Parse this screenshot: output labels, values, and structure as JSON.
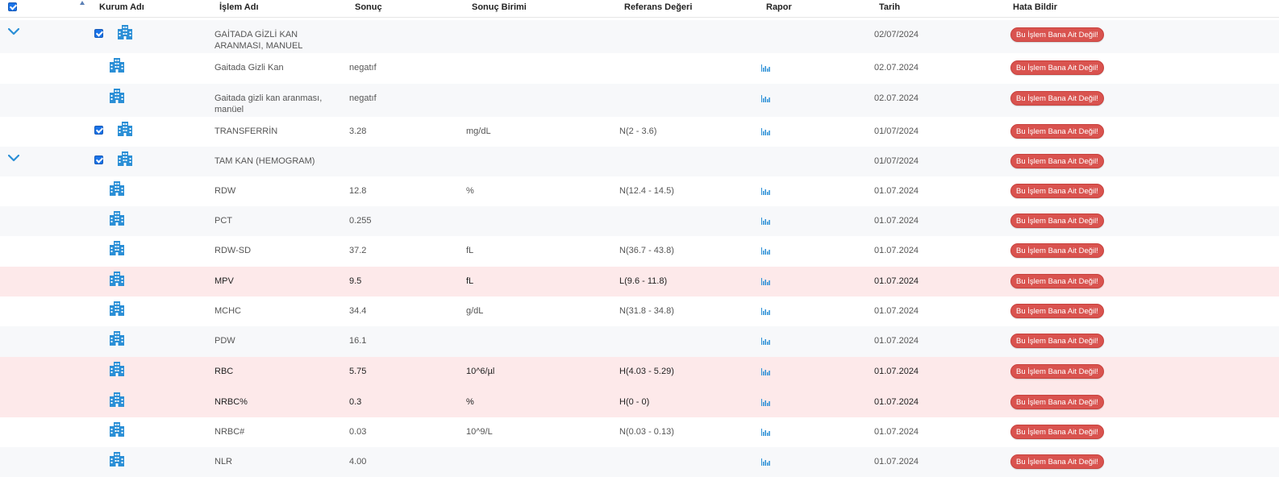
{
  "header": {
    "kurum": "Kurum Adı",
    "islem": "İşlem Adı",
    "sonuc": "Sonuç",
    "birim": "Sonuç Birimi",
    "referans": "Referans Değeri",
    "rapor": "Rapor",
    "tarih": "Tarih",
    "hata": "Hata Bildir"
  },
  "button_label": "Bu İşlem Bana Ait Değil!",
  "colors": {
    "accent": "#1a73e8",
    "error_button": "#d9534f",
    "abnormal_row": "#fde9ea",
    "icon_blue": "#2b8fd6"
  },
  "rows": [
    {
      "type": "group",
      "expand": true,
      "checkbox": true,
      "name": "GAİTADA GİZLİ KAN ARANMASI, MANUEL",
      "name_lines": [
        "GAİTADA GİZLİ KAN",
        "ARANMASI, MANUEL"
      ],
      "value": "",
      "unit": "",
      "ref": "",
      "rapor": false,
      "date": "02/07/2024"
    },
    {
      "type": "child",
      "name": "Gaitada Gizli Kan",
      "name_lines": [
        "Gaitada Gizli Kan"
      ],
      "value": "negatıf",
      "unit": "",
      "ref": "",
      "rapor": true,
      "date": "02.07.2024"
    },
    {
      "type": "child",
      "name": "Gaitada gizli kan aranması, manüel",
      "name_lines": [
        "Gaitada gizli kan aranması,",
        "manüel"
      ],
      "value": "negatıf",
      "unit": "",
      "ref": "",
      "rapor": true,
      "date": "02.07.2024"
    },
    {
      "type": "single",
      "checkbox": true,
      "name": "TRANSFERRİN",
      "name_lines": [
        "TRANSFERRİN"
      ],
      "value": "3.28",
      "unit": "mg/dL",
      "ref": "N(2 - 3.6)",
      "rapor": true,
      "date": "01/07/2024"
    },
    {
      "type": "group",
      "expand": true,
      "checkbox": true,
      "name": "TAM KAN (HEMOGRAM)",
      "name_lines": [
        "TAM KAN (HEMOGRAM)"
      ],
      "value": "",
      "unit": "",
      "ref": "",
      "rapor": false,
      "date": "01/07/2024"
    },
    {
      "type": "child",
      "name": "RDW",
      "name_lines": [
        "RDW"
      ],
      "value": "12.8",
      "unit": "%",
      "ref": "N(12.4 - 14.5)",
      "rapor": true,
      "date": "01.07.2024"
    },
    {
      "type": "child",
      "name": "PCT",
      "name_lines": [
        "PCT"
      ],
      "value": "0.255",
      "unit": "",
      "ref": "",
      "rapor": true,
      "date": "01.07.2024"
    },
    {
      "type": "child",
      "name": "RDW-SD",
      "name_lines": [
        "RDW-SD"
      ],
      "value": "37.2",
      "unit": "fL",
      "ref": "N(36.7 - 43.8)",
      "rapor": true,
      "date": "01.07.2024"
    },
    {
      "type": "child",
      "abnormal": true,
      "name": "MPV",
      "name_lines": [
        "MPV"
      ],
      "value": "9.5",
      "unit": "fL",
      "ref": "L(9.6 - 11.8)",
      "rapor": true,
      "date": "01.07.2024"
    },
    {
      "type": "child",
      "name": "MCHC",
      "name_lines": [
        "MCHC"
      ],
      "value": "34.4",
      "unit": "g/dL",
      "ref": "N(31.8 - 34.8)",
      "rapor": true,
      "date": "01.07.2024"
    },
    {
      "type": "child",
      "name": "PDW",
      "name_lines": [
        "PDW"
      ],
      "value": "16.1",
      "unit": "",
      "ref": "",
      "rapor": true,
      "date": "01.07.2024"
    },
    {
      "type": "child",
      "abnormal": true,
      "name": "RBC",
      "name_lines": [
        "RBC"
      ],
      "value": "5.75",
      "unit": "10^6/µl",
      "ref": "H(4.03 - 5.29)",
      "rapor": true,
      "date": "01.07.2024"
    },
    {
      "type": "child",
      "abnormal": true,
      "name": "NRBC%",
      "name_lines": [
        "NRBC%"
      ],
      "value": "0.3",
      "unit": "%",
      "ref": "H(0 - 0)",
      "rapor": true,
      "date": "01.07.2024"
    },
    {
      "type": "child",
      "name": "NRBC#",
      "name_lines": [
        "NRBC#"
      ],
      "value": "0.03",
      "unit": "10^9/L",
      "ref": "N(0.03 - 0.13)",
      "rapor": true,
      "date": "01.07.2024"
    },
    {
      "type": "child",
      "name": "NLR",
      "name_lines": [
        "NLR"
      ],
      "value": "4.00",
      "unit": "",
      "ref": "",
      "rapor": true,
      "date": "01.07.2024"
    }
  ]
}
